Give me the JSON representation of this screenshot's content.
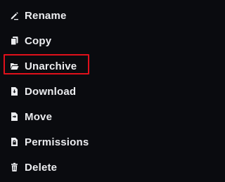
{
  "menu": {
    "items": [
      {
        "id": "rename",
        "label": "Rename",
        "icon": "pencil-icon"
      },
      {
        "id": "copy",
        "label": "Copy",
        "icon": "copy-icon"
      },
      {
        "id": "unarchive",
        "label": "Unarchive",
        "icon": "folder-open-icon",
        "highlighted": true
      },
      {
        "id": "download",
        "label": "Download",
        "icon": "file-download-icon"
      },
      {
        "id": "move",
        "label": "Move",
        "icon": "file-move-icon"
      },
      {
        "id": "permissions",
        "label": "Permissions",
        "icon": "file-lock-icon"
      },
      {
        "id": "delete",
        "label": "Delete",
        "icon": "trash-icon"
      }
    ],
    "colors": {
      "background": "#0a0b0f",
      "text": "#ecedf0",
      "highlight_border": "#e0101b"
    }
  }
}
